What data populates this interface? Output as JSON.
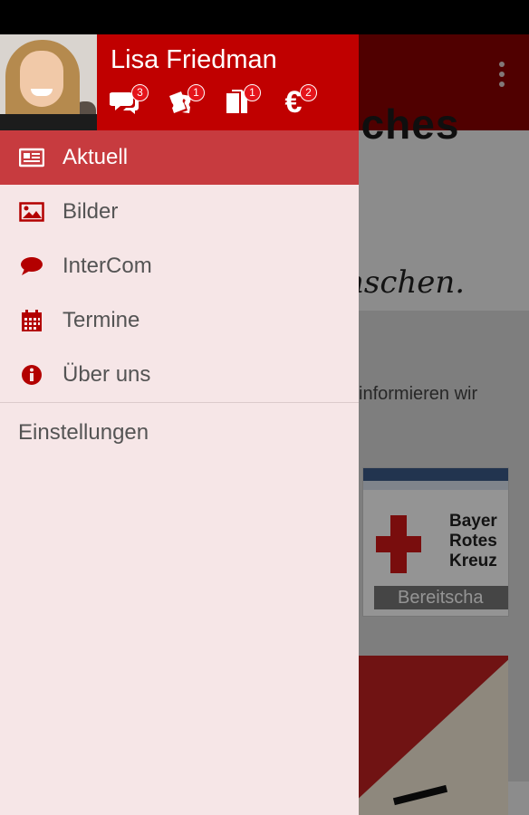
{
  "background": {
    "headline": "sches",
    "script_text": "nschen.",
    "body_text": "informieren wir",
    "thumbnail": {
      "lines": [
        "Bayer",
        "Rotes",
        "Kreuz"
      ],
      "banner": "Bereitscha"
    }
  },
  "drawer": {
    "user_name": "Lisa Friedman",
    "counters": [
      {
        "icon": "chat-bubbles-icon",
        "count": "3"
      },
      {
        "icon": "tickets-icon",
        "count": "1"
      },
      {
        "icon": "documents-icon",
        "count": "1"
      },
      {
        "icon": "euro-icon",
        "symbol": "€",
        "count": "2"
      }
    ],
    "menu": [
      {
        "icon": "newspaper-icon",
        "label": "Aktuell",
        "active": true
      },
      {
        "icon": "picture-icon",
        "label": "Bilder"
      },
      {
        "icon": "speech-bubble-icon",
        "label": "InterCom"
      },
      {
        "icon": "calendar-icon",
        "label": "Termine"
      },
      {
        "icon": "info-icon",
        "label": "Über uns"
      }
    ],
    "settings_label": "Einstellungen"
  },
  "colors": {
    "accent": "#c00000",
    "active_item": "#c73b3f",
    "drawer_bg": "#f6e6e7",
    "badge": "#e5141b"
  }
}
